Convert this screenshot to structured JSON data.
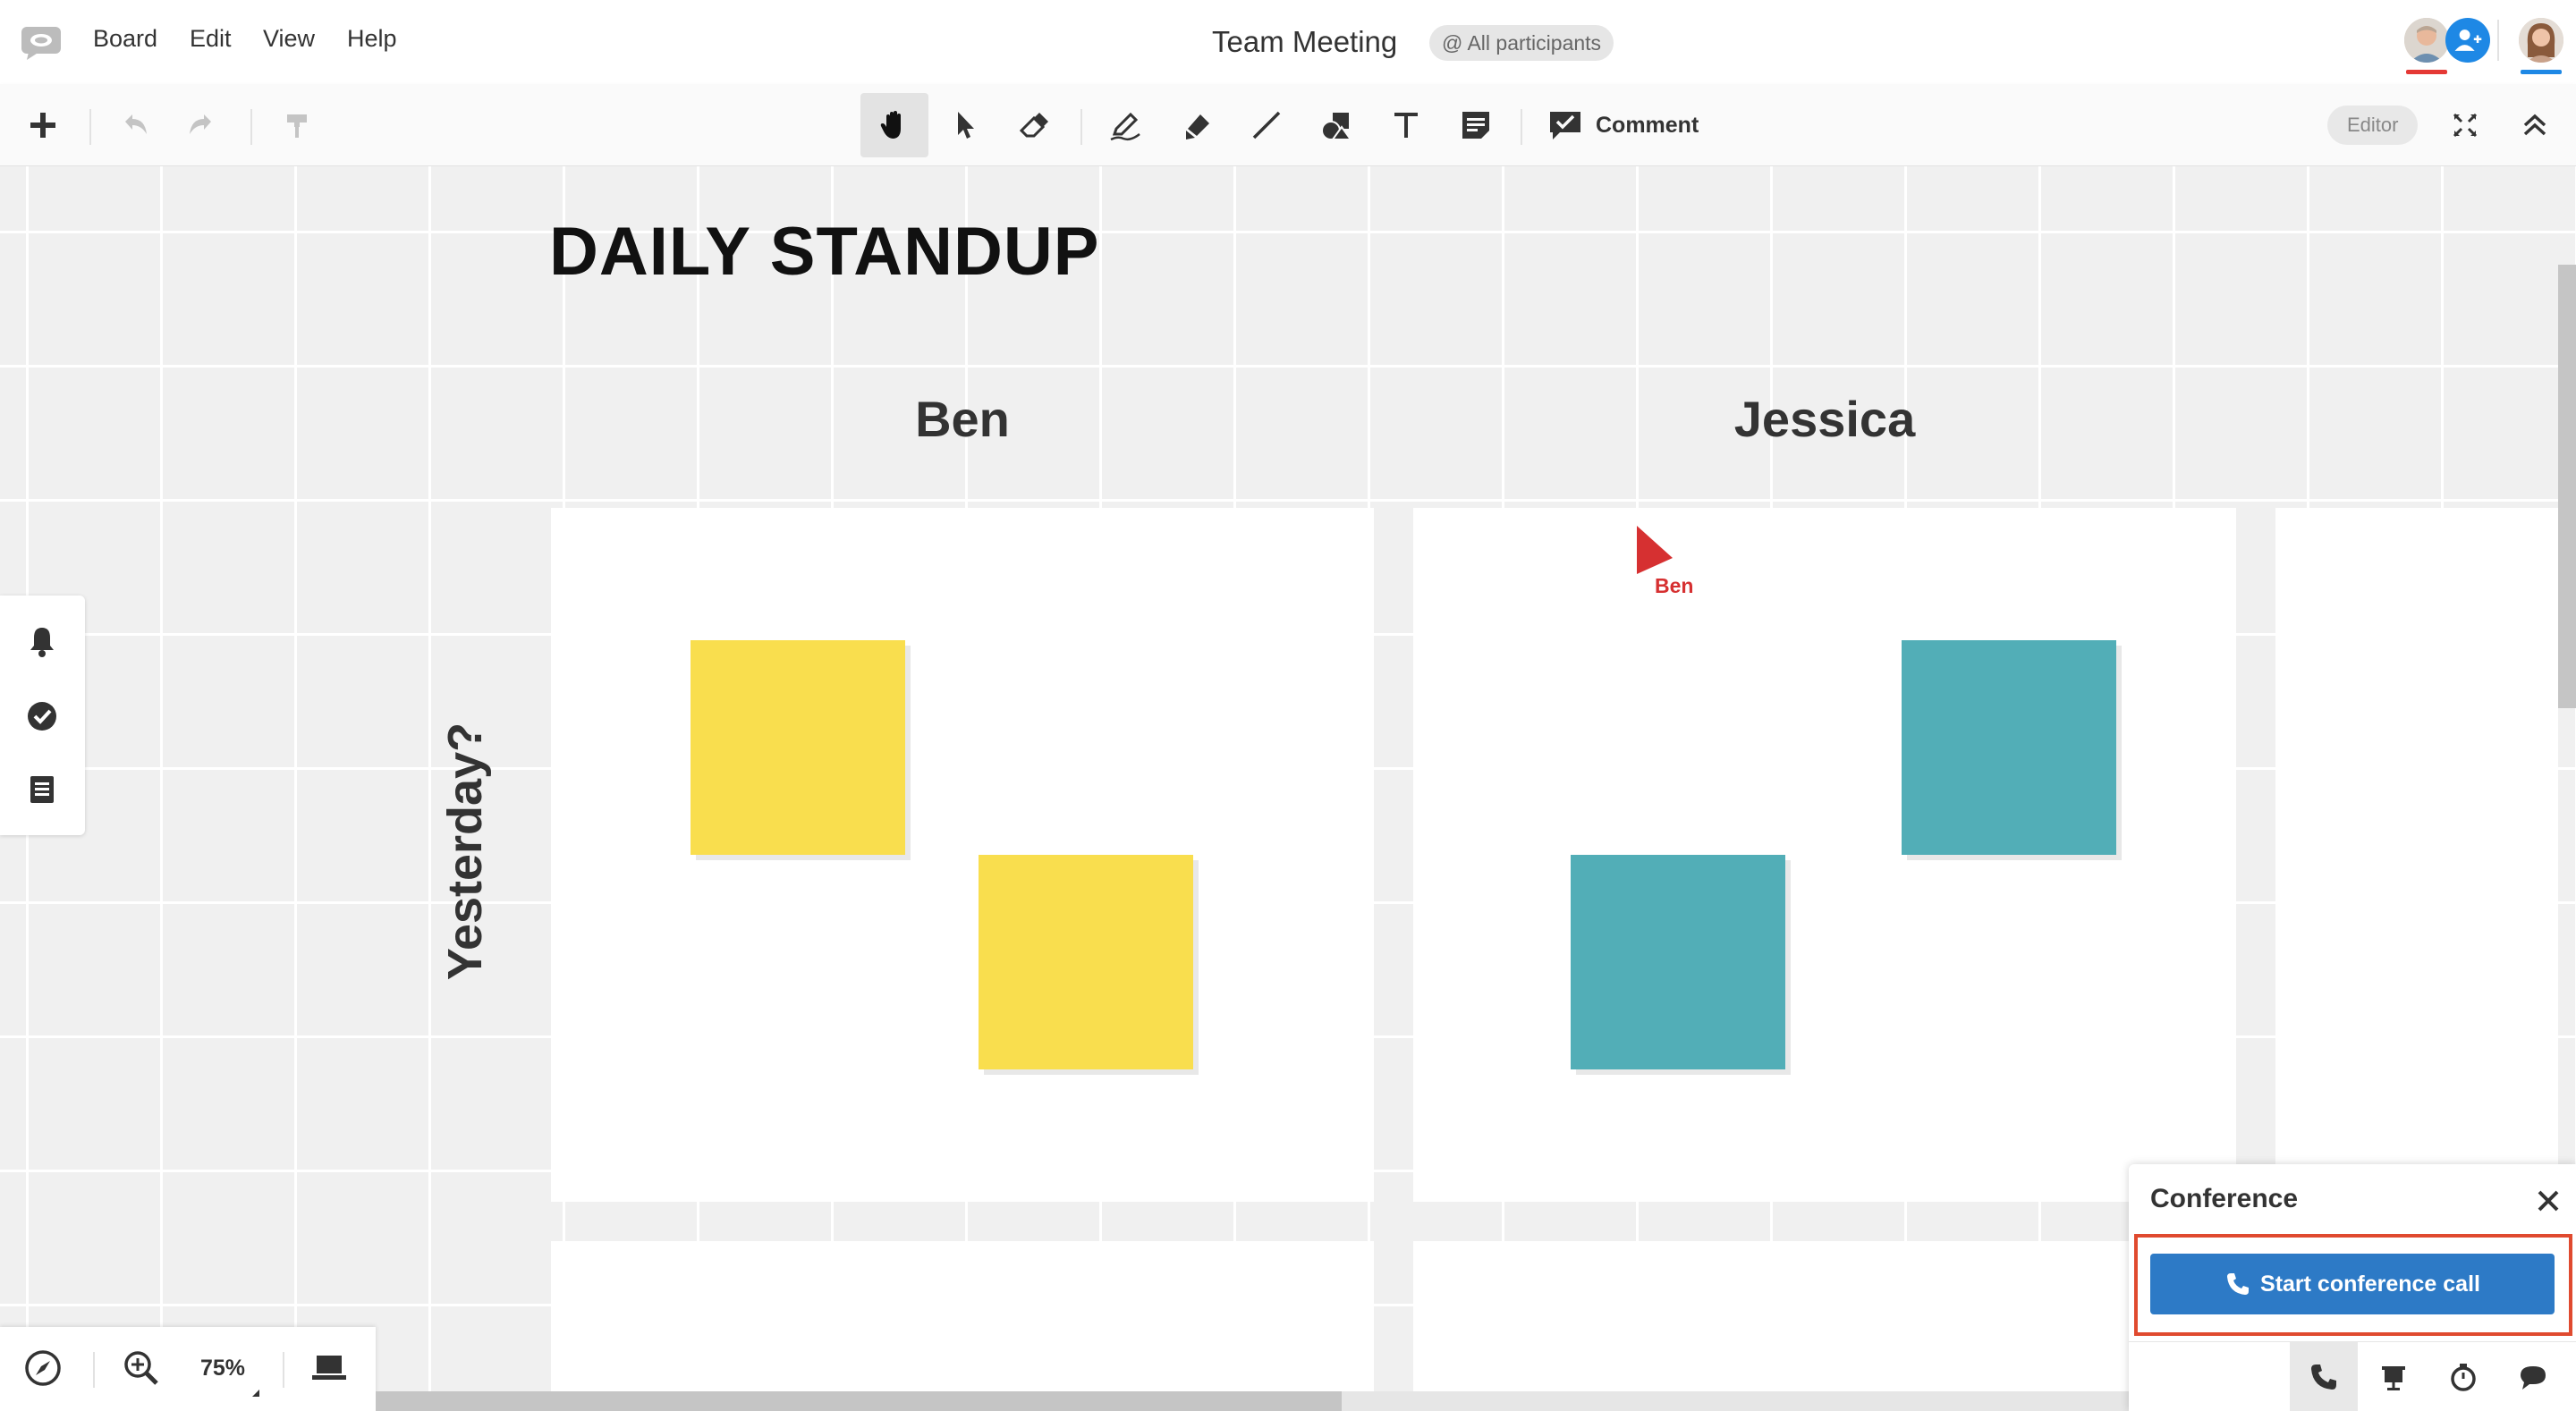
{
  "menu": {
    "items": [
      {
        "label": "Board"
      },
      {
        "label": "Edit"
      },
      {
        "label": "View"
      },
      {
        "label": "Help"
      }
    ]
  },
  "header": {
    "board_title": "Team Meeting",
    "participants_chip": "@ All participants"
  },
  "toolbar": {
    "comment_label": "Comment",
    "editor_chip": "Editor"
  },
  "board": {
    "title": "DAILY STANDUP",
    "columns": [
      {
        "label": "Ben"
      },
      {
        "label": "Jessica"
      }
    ],
    "rows": [
      {
        "label": "Yesterday?"
      }
    ],
    "remote_cursor": {
      "user": "Ben",
      "color": "#d63031"
    },
    "note_colors": {
      "ben": "#f9de4e",
      "jessica": "#52aeb7"
    }
  },
  "zoom": {
    "level": "75%"
  },
  "conference": {
    "title": "Conference",
    "start_call_label": "Start conference call",
    "button_color": "#2d7ac6",
    "highlight_color": "#e04a2f"
  },
  "presence": {
    "underline_colors": [
      "#e53935",
      "#1e88e5"
    ]
  }
}
